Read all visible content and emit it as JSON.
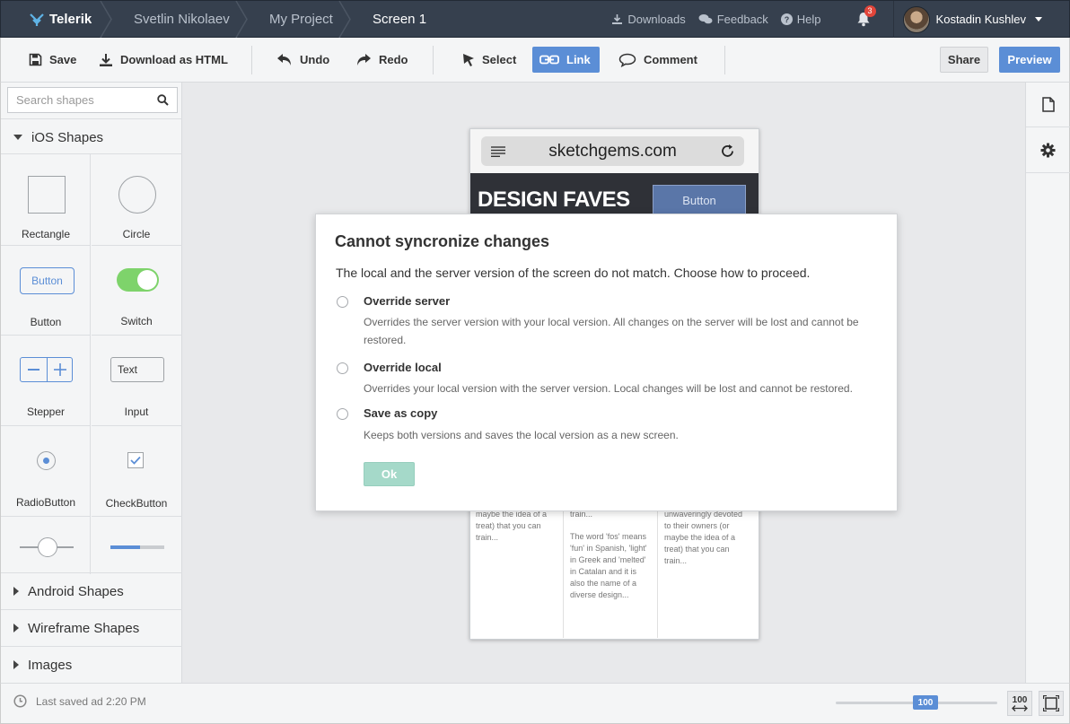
{
  "topbar": {
    "brand": "Telerik",
    "breadcrumbs": [
      "Svetlin Nikolaev",
      "My Project",
      "Screen 1"
    ],
    "links": {
      "downloads": "Downloads",
      "feedback": "Feedback",
      "help": "Help"
    },
    "notifications_count": "3",
    "user_name": "Kostadin Kushlev"
  },
  "toolbar": {
    "save": "Save",
    "download": "Download as HTML",
    "undo": "Undo",
    "redo": "Redo",
    "select": "Select",
    "link": "Link",
    "comment": "Comment",
    "share": "Share",
    "preview": "Preview"
  },
  "sidebar": {
    "search_placeholder": "Search shapes",
    "ios_section": "iOS Shapes",
    "shapes": [
      {
        "label": "Rectangle"
      },
      {
        "label": "Circle"
      },
      {
        "label": "Button",
        "preview_text": "Button"
      },
      {
        "label": "Switch"
      },
      {
        "label": "Stepper"
      },
      {
        "label": "Input",
        "preview_text": "Text"
      },
      {
        "label": "RadioButton"
      },
      {
        "label": "CheckButton"
      }
    ],
    "sections": [
      "Android Shapes",
      "Wireframe Shapes",
      "Images"
    ]
  },
  "device": {
    "url": "sketchgems.com",
    "hero_title": "DESIGN FAVES",
    "hero_button": "Button",
    "col1": [
      "maybe the idea of a treat) that you can train..."
    ],
    "col2": [
      "train...",
      "The word 'fos' means 'fun' in Spanish, 'light' in Greek and 'melted' in Catalan and it is also the name of a diverse design..."
    ],
    "col3": [
      "unwaveringly devoted to their owners (or maybe the idea of a treat) that you can train..."
    ]
  },
  "modal": {
    "title": "Cannot syncronize changes",
    "message": "The local and the server version of the screen do not match. Choose how to proceed.",
    "options": [
      {
        "title": "Override server",
        "desc": "Overrides the server version with your local version. All changes on the server will be lost and cannot be restored."
      },
      {
        "title": "Override local",
        "desc": "Overrides your local version with the server version. Local changes will be lost and cannot be restored."
      },
      {
        "title": "Save as copy",
        "desc": "Keeps both versions and saves the local version as a new screen."
      }
    ],
    "ok": "Ok"
  },
  "status": {
    "last_saved": "Last saved ad 2:20 PM",
    "zoom": "100",
    "fit_width_label": "100"
  },
  "colors": {
    "topbar": "#36404e",
    "accent": "#5b8ed6",
    "ok_disabled": "#a5d9c9",
    "switch_on": "#7ed36b"
  }
}
